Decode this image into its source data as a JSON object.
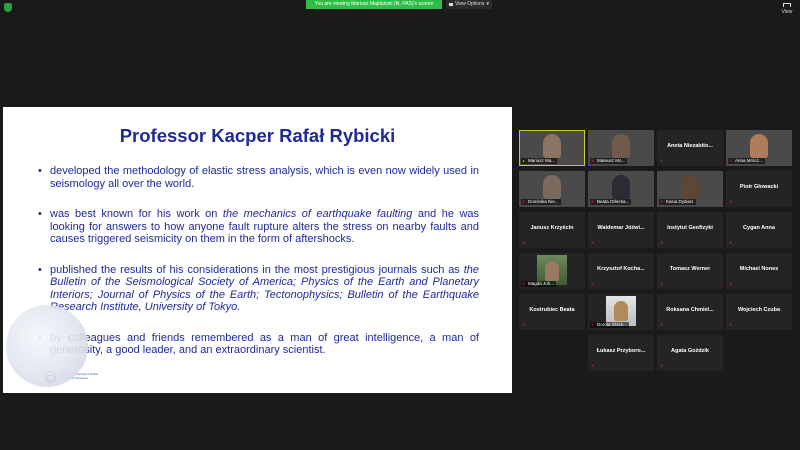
{
  "topbar": {
    "share_banner": "You are viewing Mariusz Majdański (fit. PAS)'s screen",
    "view_options": "View Options",
    "view_label": "View"
  },
  "slide": {
    "title": "Professor Kacper Rafał Rybicki",
    "bullets": [
      {
        "text": "developed the methodology of elastic stress analysis, which is even now widely used in seismology all over the world."
      },
      {
        "pre": "was best known for his work on ",
        "em": "the mechanics of earthquake faulting",
        "post": " and he was looking for answers to how anyone fault rupture alters the stress on nearby faults and causes triggered seismicity on them in the form of aftershocks."
      },
      {
        "pre": "published the results of his considerations in the most prestigious journals such as ",
        "em": "the Bulletin of the Seismological Society of America; Physics of the Earth and Planetary Interiors; Journal of Physics of the Earth; Tectonophysics; Bulletin of the Earthquake Research Institute, University of Tokyo.",
        "post": ""
      },
      {
        "text": "by colleagues and friends remembered as a man of great intelligence, a man of generosity, a good leader, and an extraordinary scientist."
      }
    ],
    "logo_text": "Institute of Geophysics Polish Academy of Sciences"
  },
  "participants": [
    {
      "name": "Mariusz Ma...",
      "video": true,
      "active": true
    },
    {
      "name": "Mateusz Mo...",
      "video": true
    },
    {
      "name": "Aneta Niezabito...",
      "video": false
    },
    {
      "name": "Anna Mrócz...",
      "video": true
    },
    {
      "name": "Dominika Nie...",
      "video": true
    },
    {
      "name": "Beata Orlecka...",
      "video": true
    },
    {
      "name": "Kasia Dydusz",
      "video": true
    },
    {
      "name": "Piotr Głowacki",
      "video": false
    },
    {
      "name": "Janusz Krzyścin",
      "video": false
    },
    {
      "name": "Waldemar Jóźwi...",
      "video": false
    },
    {
      "name": "Instytut Geofizyki",
      "video": false
    },
    {
      "name": "Cygan Anna",
      "video": false
    },
    {
      "name": "Magda Joh...",
      "video": true
    },
    {
      "name": "Krzysztof Kocha...",
      "video": false
    },
    {
      "name": "Tomasz Werner",
      "video": false
    },
    {
      "name": "Michael Nones",
      "video": false
    },
    {
      "name": "Kostrubiec Beata",
      "video": false
    },
    {
      "name": "Dorota Olsze...",
      "video": true
    },
    {
      "name": "Roksana Chmiel...",
      "video": false
    },
    {
      "name": "Wojciech Czuba",
      "video": false
    },
    {
      "name": "Łukasz Przyboro...",
      "video": false
    },
    {
      "name": "Agata Goździk",
      "video": false
    }
  ],
  "colors": {
    "slide_text": "#1f2a99",
    "banner": "#2fbd48",
    "active_border": "#c8d21a",
    "muted_mic": "#e03030"
  }
}
